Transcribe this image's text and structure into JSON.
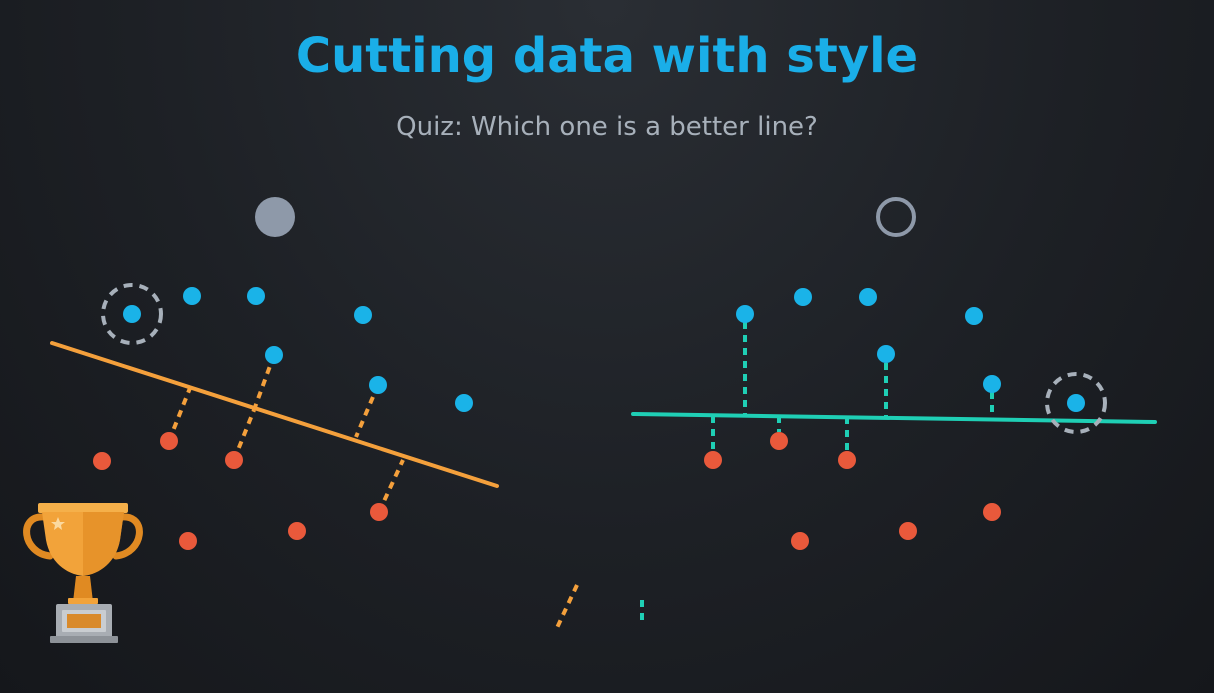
{
  "title": "Cutting data with style",
  "subtitle": "Quiz: Which one is a better line?",
  "colors": {
    "accent": "#1aaee8",
    "subtitle": "#a7b0ba",
    "blue_point": "#1ab3e8",
    "red_point": "#e9593b",
    "orange_line": "#f4a03c",
    "teal_line": "#1fcfb5",
    "option_selected": "#8e99a9",
    "option_unselected": "#8e99a9",
    "highlight_ring": "#a7b0ba",
    "trophy_gold": "#f2a33a",
    "trophy_base": "#a8adb3"
  },
  "options": [
    {
      "name": "left-line",
      "selected": true
    },
    {
      "name": "right-line",
      "selected": false
    }
  ],
  "icons": [
    "trophy-icon",
    "radio-selected-icon",
    "radio-unselected-icon"
  ]
}
